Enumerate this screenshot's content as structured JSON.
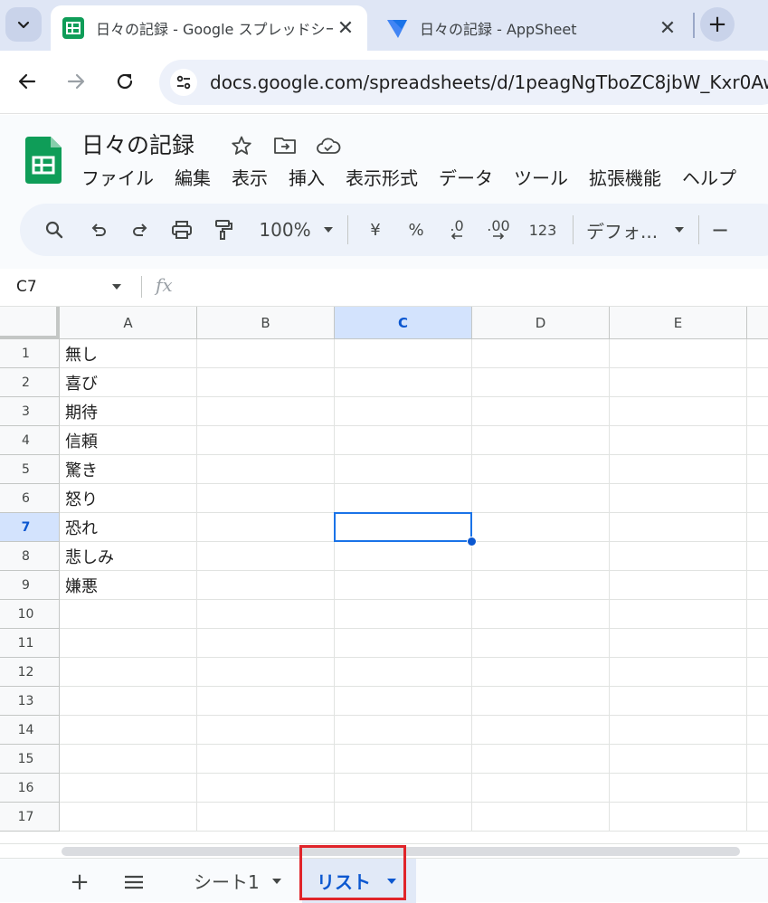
{
  "browser": {
    "tabs": [
      {
        "title": "日々の記録 - Google スプレッドシー",
        "icon": "sheets-favicon",
        "active": true
      },
      {
        "title": "日々の記録 - AppSheet",
        "icon": "appsheet-favicon",
        "active": false
      }
    ],
    "url": "docs.google.com/spreadsheets/d/1peagNgTboZC8jbW_Kxr0AwMU"
  },
  "doc": {
    "title": "日々の記録",
    "menu": [
      "ファイル",
      "編集",
      "表示",
      "挿入",
      "表示形式",
      "データ",
      "ツール",
      "拡張機能",
      "ヘルプ"
    ]
  },
  "toolbar": {
    "zoom": "100%",
    "currency": "¥",
    "percent": "%",
    "decrease_decimal": ".0",
    "increase_decimal": ".00",
    "number_format": "123",
    "font": "デフォ...",
    "minus": "−"
  },
  "formula_bar": {
    "cell_ref": "C7",
    "fx": "fx"
  },
  "grid": {
    "columns": [
      "A",
      "B",
      "C",
      "D",
      "E"
    ],
    "selected_column": "C",
    "selected_row": 7,
    "rows": [
      "1",
      "2",
      "3",
      "4",
      "5",
      "6",
      "7",
      "8",
      "9",
      "10",
      "11",
      "12",
      "13",
      "14",
      "15",
      "16",
      "17"
    ],
    "column_a": [
      "無し",
      "喜び",
      "期待",
      "信頼",
      "驚き",
      "怒り",
      "恐れ",
      "悲しみ",
      "嫌悪"
    ]
  },
  "sheet_tabs": {
    "add": "+",
    "tabs": [
      {
        "label": "シート1",
        "active": false
      },
      {
        "label": "リスト",
        "active": true
      }
    ]
  },
  "colors": {
    "accent": "#0b57d0",
    "selection": "#1a73e8",
    "sheets_green": "#0f9d58",
    "highlight_red": "#e0242a"
  }
}
